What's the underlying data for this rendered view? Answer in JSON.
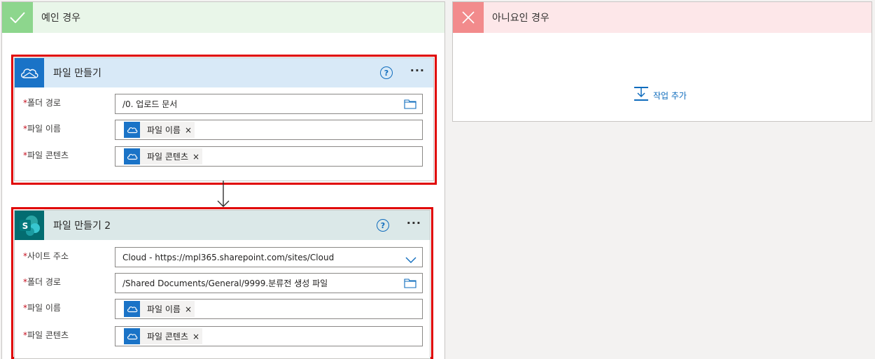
{
  "yes_branch": {
    "title": "예인 경우",
    "icon": "check-icon",
    "color": "#8dd68d"
  },
  "no_branch": {
    "title": "아니요인 경우",
    "icon": "x-icon",
    "color": "#f28b8c",
    "add_action_label": "작업 추가"
  },
  "card1": {
    "title": "파일 만들기",
    "connector_icon": "onedrive-icon",
    "help_glyph": "?",
    "more_glyph": "···",
    "fields": [
      {
        "label": "폴더 경로",
        "value": "/0. 업로드 문서"
      },
      {
        "label": "파일 이름",
        "token": "파일 이름"
      },
      {
        "label": "파일 콘텐츠",
        "token": "파일 콘텐츠"
      }
    ],
    "required_mark": "*",
    "token_remove": "×"
  },
  "card2": {
    "title": "파일 만들기 2",
    "connector_icon": "sharepoint-icon",
    "help_glyph": "?",
    "more_glyph": "···",
    "fields": [
      {
        "label": "사이트 주소",
        "value": "Cloud - https://mpl365.sharepoint.com/sites/Cloud"
      },
      {
        "label": "폴더 경로",
        "value": "/Shared Documents/General/9999.분류전 생성 파일"
      },
      {
        "label": "파일 이름",
        "token": "파일 이름"
      },
      {
        "label": "파일 콘텐츠",
        "token": "파일 콘텐츠"
      }
    ],
    "required_mark": "*",
    "token_remove": "×"
  },
  "colors": {
    "highlight": "#e00000",
    "accent": "#0f6cbd"
  }
}
